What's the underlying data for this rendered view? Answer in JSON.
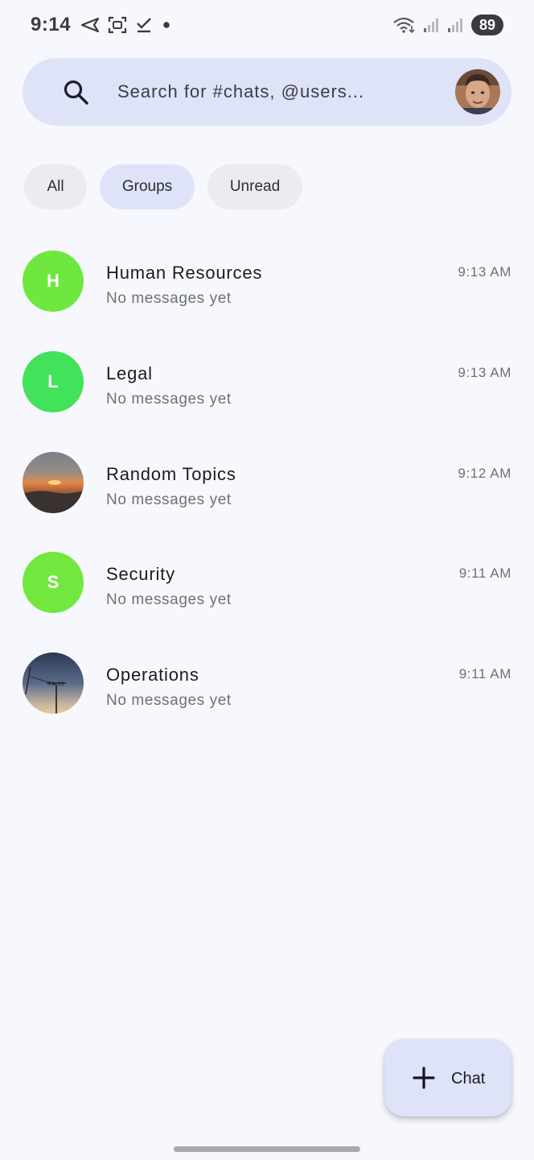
{
  "status_bar": {
    "time": "9:14",
    "battery": "89"
  },
  "search": {
    "placeholder": "Search for #chats, @users..."
  },
  "filters": {
    "all": "All",
    "groups": "Groups",
    "unread": "Unread",
    "selected": "Groups"
  },
  "chats": [
    {
      "name": "Human Resources",
      "preview": "No messages yet",
      "time": "9:13 AM",
      "initial": "H",
      "avatar_color": "#6ee83f"
    },
    {
      "name": "Legal",
      "preview": "No messages yet",
      "time": "9:13 AM",
      "initial": "L",
      "avatar_color": "#42e25a"
    },
    {
      "name": "Random Topics",
      "preview": "No messages yet",
      "time": "9:12 AM",
      "initial": "",
      "avatar_color": "#6a6560"
    },
    {
      "name": "Security",
      "preview": "No messages yet",
      "time": "9:11 AM",
      "initial": "S",
      "avatar_color": "#72e83e"
    },
    {
      "name": "Operations",
      "preview": "No messages yet",
      "time": "9:11 AM",
      "initial": "",
      "avatar_color": "#3d4a66"
    }
  ],
  "fab": {
    "label": "Chat"
  },
  "colors": {
    "background": "#f7f8fd",
    "accent_container": "#dee3f7",
    "chip_background": "#ebecf1"
  }
}
